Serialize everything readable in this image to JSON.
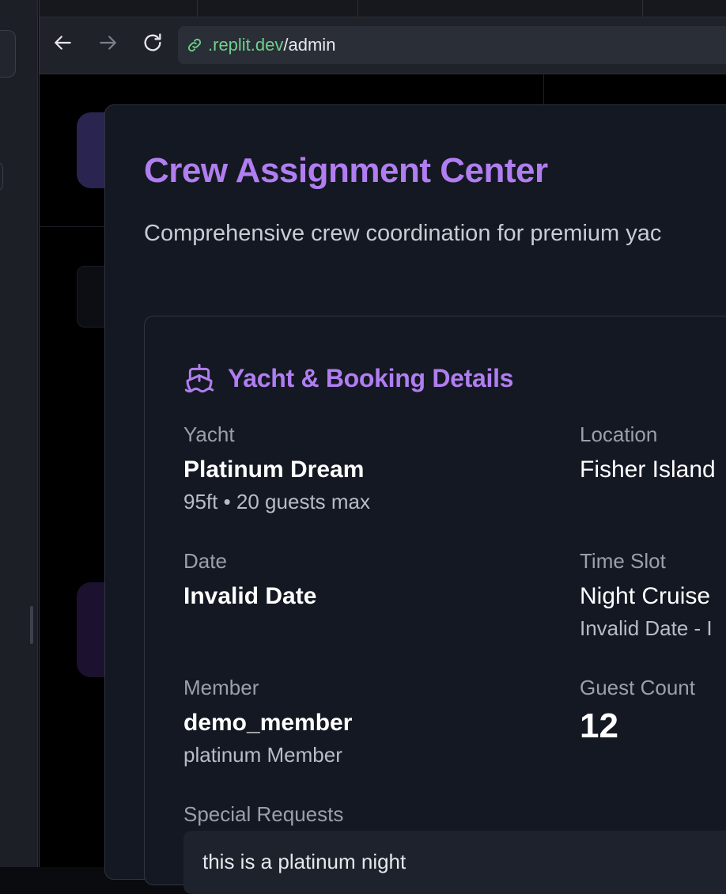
{
  "browser": {
    "url_host": ".replit.dev",
    "url_path": "/admin"
  },
  "modal": {
    "title": "Crew Assignment Center",
    "subtitle": "Comprehensive crew coordination for premium yac",
    "details": {
      "heading": "Yacht & Booking Details",
      "yacht": {
        "label": "Yacht",
        "value": "Platinum Dream",
        "sub": "95ft • 20 guests max"
      },
      "location": {
        "label": "Location",
        "value": "Fisher Island"
      },
      "date": {
        "label": "Date",
        "value": "Invalid Date"
      },
      "time_slot": {
        "label": "Time Slot",
        "value": "Night Cruise",
        "sub": "Invalid Date - I"
      },
      "member": {
        "label": "Member",
        "value": "demo_member",
        "sub": "platinum Member"
      },
      "guest_count": {
        "label": "Guest Count",
        "value": "12"
      },
      "special_requests": {
        "label": "Special Requests",
        "value": "this is a platinum night"
      }
    }
  },
  "colors": {
    "accent": "#b07ef0",
    "modal_bg": "#141822",
    "url_host": "#6fd08a"
  },
  "icons": {
    "back": "arrow-left-icon",
    "forward": "arrow-right-icon",
    "reload": "reload-icon",
    "link": "link-icon",
    "ship": "ship-icon"
  }
}
